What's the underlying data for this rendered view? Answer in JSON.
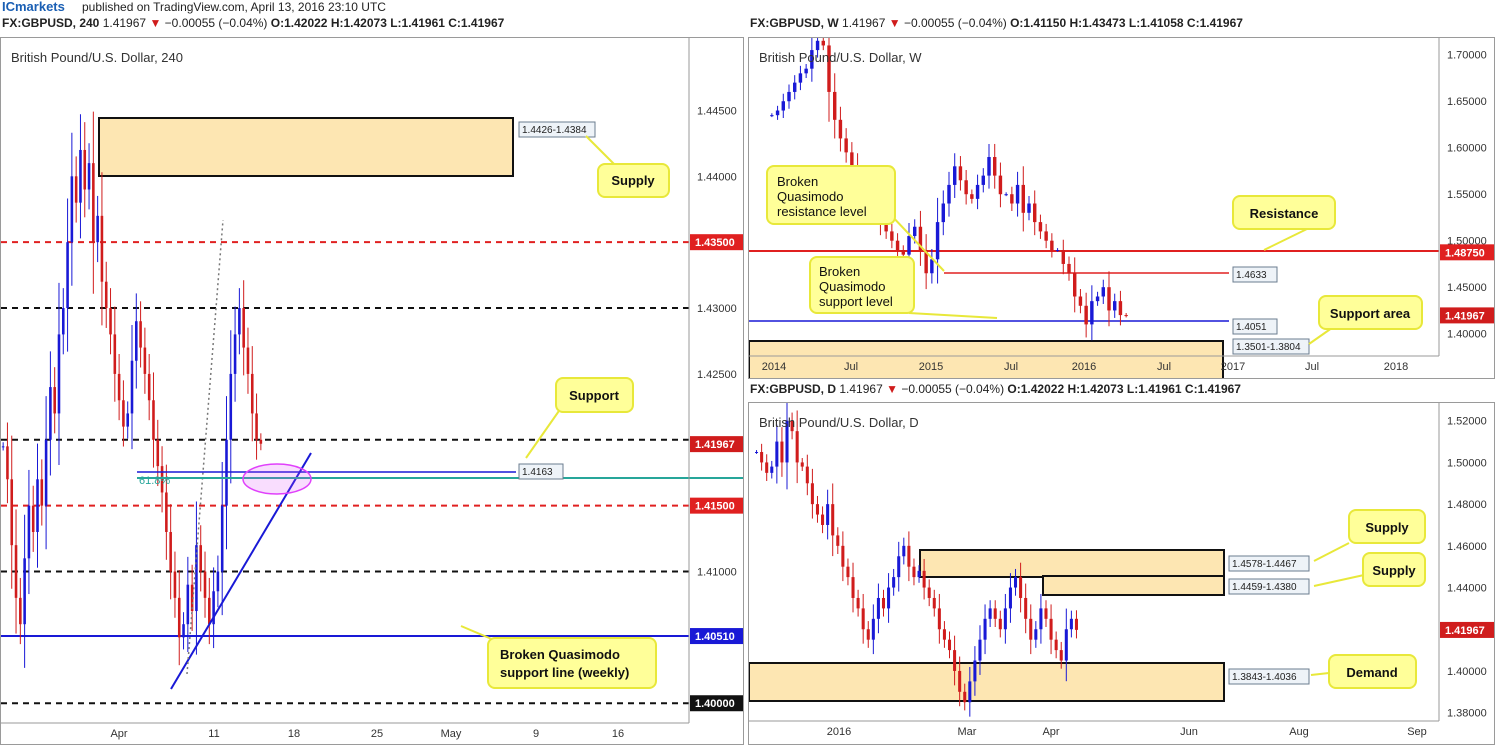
{
  "brand": "ICmarkets",
  "published": "published on TradingView.com, April 13, 2016 23:10 UTC",
  "colors": {
    "up": "#1919d6",
    "down": "#d01c1c",
    "zone_fill": "#fde6b2",
    "callout_fill": "#ffff99",
    "callout_border": "#e8e83a",
    "fib": "#26a69a",
    "ellipse": "#e040fb"
  },
  "panels": {
    "h4": {
      "header_symbol": "FX:GBPUSD, 240",
      "header_last": "1.41967",
      "header_change": "−0.00055 (−0.04%)",
      "header_o": "O:1.42022",
      "header_h": "H:1.42073",
      "header_l": "L:1.41961",
      "header_c": "C:1.41967",
      "title": "British Pound/U.S. Dollar, 240"
    },
    "w": {
      "header_symbol": "FX:GBPUSD, W",
      "header_last": "1.41967",
      "header_change": "−0.00055 (−0.04%)",
      "header_o": "O:1.41150",
      "header_h": "H:1.43473",
      "header_l": "L:1.41058",
      "header_c": "C:1.41967",
      "title": "British Pound/U.S. Dollar, W"
    },
    "d": {
      "header_symbol": "FX:GBPUSD, D",
      "header_last": "1.41967",
      "header_change": "−0.00055 (−0.04%)",
      "header_o": "O:1.42022",
      "header_h": "H:1.42073",
      "header_l": "L:1.41961",
      "header_c": "C:1.41967",
      "title": "British Pound/U.S. Dollar, D"
    }
  },
  "chart_data": [
    {
      "id": "h4",
      "type": "candlestick",
      "title": "British Pound/U.S. Dollar, 240",
      "ylim": [
        1.3985,
        1.4505
      ],
      "y_ticks": [
        "1.44500",
        "1.44000",
        "1.43500",
        "1.43000",
        "1.42500",
        "1.42000",
        "1.41500",
        "1.41000",
        "1.40510",
        "1.40000"
      ],
      "x_ticks": [
        "Apr",
        "11",
        "18",
        "25",
        "May",
        "9",
        "16"
      ],
      "last_price": "1.41967",
      "close_series": [
        1.4195,
        1.417,
        1.412,
        1.408,
        1.406,
        1.411,
        1.415,
        1.413,
        1.417,
        1.415,
        1.42,
        1.424,
        1.422,
        1.428,
        1.43,
        1.435,
        1.44,
        1.438,
        1.442,
        1.439,
        1.441,
        1.435,
        1.437,
        1.432,
        1.43,
        1.428,
        1.425,
        1.423,
        1.421,
        1.422,
        1.426,
        1.429,
        1.427,
        1.425,
        1.423,
        1.42,
        1.418,
        1.416,
        1.413,
        1.41,
        1.408,
        1.405,
        1.406,
        1.409,
        1.407,
        1.412,
        1.41,
        1.408,
        1.406,
        1.4085,
        1.41,
        1.415,
        1.42,
        1.425,
        1.428,
        1.43,
        1.427,
        1.425,
        1.422,
        1.42,
        1.4197
      ],
      "levels": [
        {
          "label": "1.43500",
          "price": 1.435,
          "style": "red-dash",
          "tag": true
        },
        {
          "label": "1.43000",
          "price": 1.43,
          "style": "black-dash",
          "tag": false
        },
        {
          "label": "1.42000",
          "price": 1.42,
          "style": "black-dash",
          "tag": false
        },
        {
          "label": "1.41500",
          "price": 1.415,
          "style": "red-dash",
          "tag": true
        },
        {
          "label": "1.41000",
          "price": 1.41,
          "style": "black-dash",
          "tag": false
        },
        {
          "label": "1.40510",
          "price": 1.4051,
          "style": "blue",
          "tag": true
        },
        {
          "label": "1.40000",
          "price": 1.4,
          "style": "black-dash",
          "tag": true
        }
      ],
      "zones": [
        {
          "label": "1.4426-1.4384",
          "top": 1.4426,
          "bottom": 1.4384
        }
      ],
      "ray_labels": [
        {
          "label": "1.4163",
          "price": 1.4163
        }
      ],
      "fib_label": "61.8%",
      "annotations": [
        "Supply",
        "Support",
        "Broken Quasimodo support line (weekly)"
      ]
    },
    {
      "id": "w",
      "type": "candlestick",
      "title": "British Pound/U.S. Dollar, W",
      "ylim": [
        1.376,
        1.718
      ],
      "y_ticks": [
        "1.70000",
        "1.65000",
        "1.60000",
        "1.55000",
        "1.50000",
        "1.45000",
        "1.40000"
      ],
      "x_ticks": [
        "2014",
        "Jul",
        "2015",
        "Jul",
        "2016",
        "Jul",
        "2017",
        "Jul",
        "2018"
      ],
      "last_price": "1.41967",
      "resistance_tag": "1.48750",
      "close_series": [
        1.635,
        1.64,
        1.65,
        1.66,
        1.67,
        1.68,
        1.685,
        1.705,
        1.715,
        1.71,
        1.66,
        1.63,
        1.61,
        1.595,
        1.58,
        1.56,
        1.565,
        1.55,
        1.54,
        1.52,
        1.51,
        1.5,
        1.49,
        1.485,
        1.505,
        1.515,
        1.49,
        1.465,
        1.48,
        1.52,
        1.54,
        1.56,
        1.58,
        1.565,
        1.55,
        1.545,
        1.56,
        1.57,
        1.59,
        1.57,
        1.55,
        1.55,
        1.54,
        1.56,
        1.53,
        1.54,
        1.52,
        1.51,
        1.5,
        1.49,
        1.49,
        1.475,
        1.465,
        1.44,
        1.43,
        1.41,
        1.435,
        1.44,
        1.45,
        1.425,
        1.435,
        1.42,
        1.4197
      ],
      "levels": [
        {
          "label": "1.4633",
          "price": 1.4633
        },
        {
          "label": "1.4051",
          "price": 1.4051
        },
        {
          "label": "Resistance",
          "price": 1.4875
        }
      ],
      "zones": [
        {
          "label": "1.3501-1.3804",
          "top": 1.3804,
          "bottom": 1.3501
        }
      ],
      "annotations": [
        "Broken Quasimodo resistance level",
        "Broken Quasimodo support level",
        "Resistance",
        "Support area"
      ]
    },
    {
      "id": "d",
      "type": "candlestick",
      "title": "British Pound/U.S. Dollar, D",
      "ylim": [
        1.376,
        1.5285
      ],
      "y_ticks": [
        "1.52000",
        "1.50000",
        "1.48000",
        "1.46000",
        "1.44000",
        "1.42000",
        "1.40000",
        "1.38000"
      ],
      "x_ticks": [
        "2016",
        "Mar",
        "Apr",
        "Jun",
        "Aug",
        "Sep"
      ],
      "last_price": "1.41967",
      "close_series": [
        1.505,
        1.5,
        1.495,
        1.498,
        1.51,
        1.5,
        1.52,
        1.515,
        1.5,
        1.498,
        1.49,
        1.48,
        1.475,
        1.47,
        1.48,
        1.465,
        1.46,
        1.45,
        1.445,
        1.435,
        1.43,
        1.42,
        1.415,
        1.425,
        1.435,
        1.43,
        1.44,
        1.445,
        1.455,
        1.46,
        1.45,
        1.445,
        1.448,
        1.44,
        1.435,
        1.43,
        1.42,
        1.415,
        1.41,
        1.4,
        1.39,
        1.385,
        1.395,
        1.405,
        1.415,
        1.425,
        1.43,
        1.425,
        1.42,
        1.43,
        1.44,
        1.445,
        1.435,
        1.425,
        1.415,
        1.42,
        1.43,
        1.425,
        1.415,
        1.41,
        1.405,
        1.42,
        1.425,
        1.4197
      ],
      "zones": [
        {
          "label": "1.4578-1.4467",
          "top": 1.4578,
          "bottom": 1.4467
        },
        {
          "label": "1.4459-1.4380",
          "top": 1.4459,
          "bottom": 1.438
        },
        {
          "label": "1.3843-1.4036",
          "top": 1.4036,
          "bottom": 1.3843
        }
      ],
      "annotations": [
        "Supply",
        "Supply",
        "Demand"
      ]
    }
  ]
}
